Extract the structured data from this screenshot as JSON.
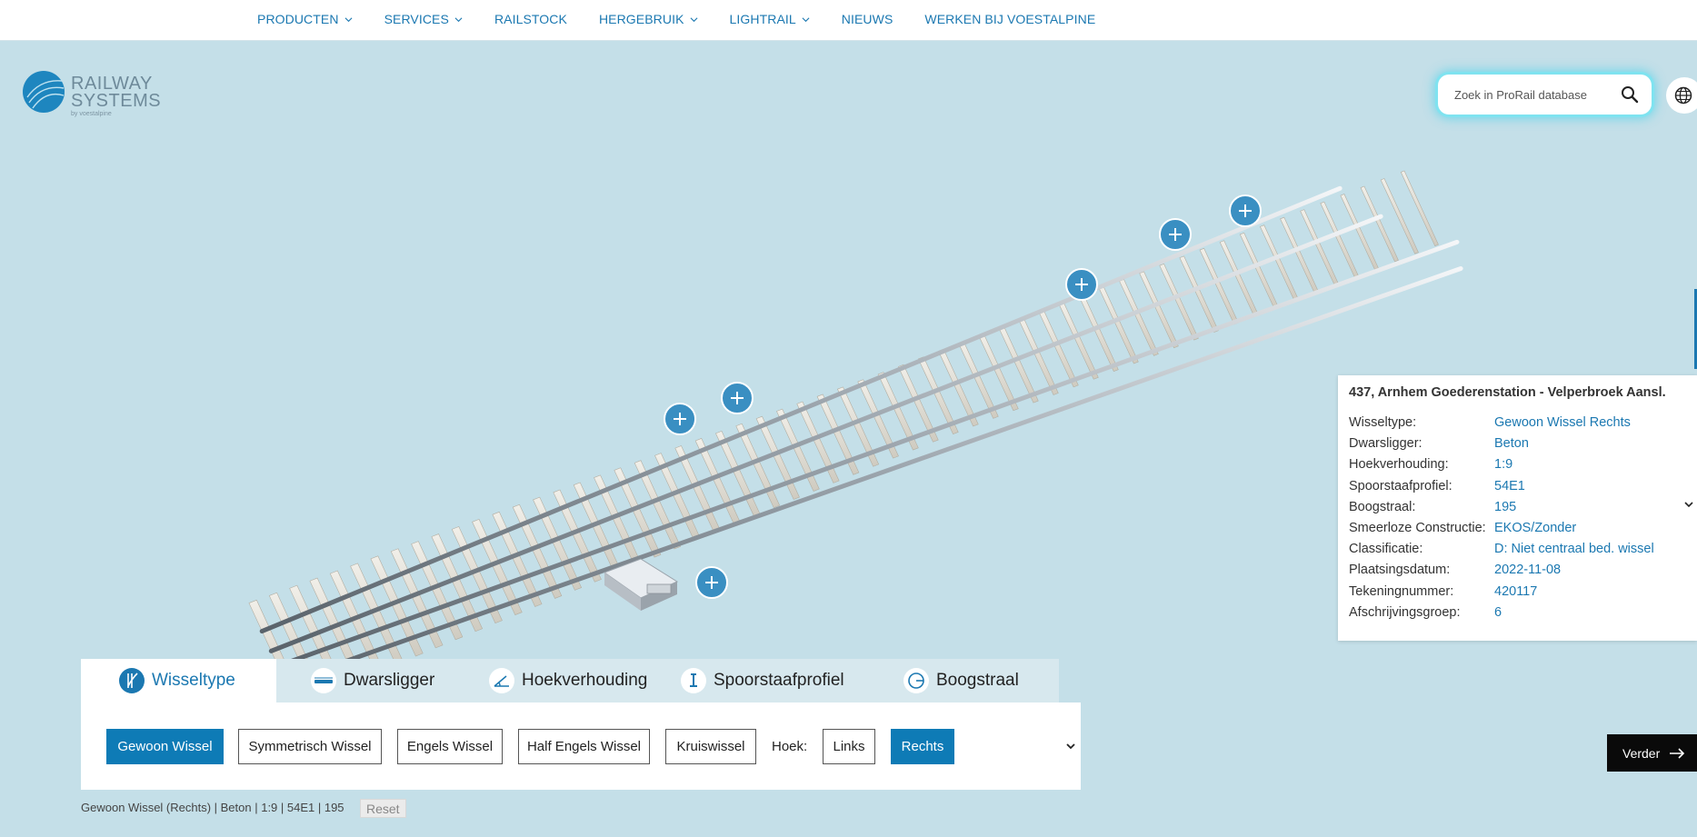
{
  "nav": {
    "items": [
      {
        "label": "PRODUCTEN",
        "dropdown": true
      },
      {
        "label": "SERVICES",
        "dropdown": true
      },
      {
        "label": "RAILSTOCK",
        "dropdown": false
      },
      {
        "label": "HERGEBRUIK",
        "dropdown": true
      },
      {
        "label": "LIGHTRAIL",
        "dropdown": true
      },
      {
        "label": "NIEUWS",
        "dropdown": false
      },
      {
        "label": "WERKEN BIJ VOESTALPINE",
        "dropdown": false
      }
    ]
  },
  "logo": {
    "line1": "RAILWAY",
    "line2": "SYSTEMS",
    "line3": "by voestalpine"
  },
  "search": {
    "placeholder": "Zoek in ProRail database"
  },
  "info": {
    "title": "437, Arnhem Goederenstation - Velperbroek Aansl.",
    "rows": [
      {
        "key": "Wisseltype:",
        "value": "Gewoon Wissel Rechts"
      },
      {
        "key": "Dwarsligger:",
        "value": "Beton"
      },
      {
        "key": "Hoekverhouding:",
        "value": "1:9"
      },
      {
        "key": "Spoorstaafprofiel:",
        "value": "54E1"
      },
      {
        "key": "Boogstraal:",
        "value": "195"
      },
      {
        "key": "Smeerloze Constructie:",
        "value": "EKOS/Zonder"
      },
      {
        "key": "Classificatie:",
        "value": "D: Niet centraal bed. wissel"
      },
      {
        "key": "Plaatsingsdatum:",
        "value": "2022-11-08"
      },
      {
        "key": "Tekeningnummer:",
        "value": "420117"
      },
      {
        "key": "Afschrijvingsgroep:",
        "value": "6"
      }
    ]
  },
  "tabs": [
    {
      "label": "Wisseltype",
      "active": true
    },
    {
      "label": "Dwarsligger",
      "active": false
    },
    {
      "label": "Hoekverhouding",
      "active": false
    },
    {
      "label": "Spoorstaafprofiel",
      "active": false
    },
    {
      "label": "Boogstraal",
      "active": false
    }
  ],
  "options": {
    "types": [
      {
        "label": "Gewoon Wissel",
        "selected": true
      },
      {
        "label": "Symmetrisch Wissel",
        "selected": false
      },
      {
        "label": "Engels Wissel",
        "selected": false
      },
      {
        "label": "Half Engels Wissel",
        "selected": false
      },
      {
        "label": "Kruiswissel",
        "selected": false
      }
    ],
    "hoek_label": "Hoek:",
    "hoek": [
      {
        "label": "Links",
        "selected": false
      },
      {
        "label": "Rechts",
        "selected": true
      }
    ]
  },
  "summary": "Gewoon Wissel (Rechts) | Beton | 1:9 | 54E1 | 195",
  "reset_label": "Reset",
  "verder_label": "Verder",
  "colors": {
    "accent": "#1b78b1",
    "background": "#c4dfe8",
    "hotspot": "#3a8fc2"
  }
}
